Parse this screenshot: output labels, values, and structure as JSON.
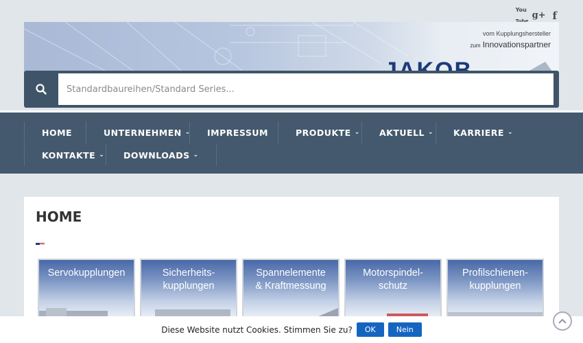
{
  "social": {
    "youtube_line1": "You",
    "youtube_line2": "Tube",
    "googleplus": "g+",
    "facebook": "f"
  },
  "banner": {
    "tagline_line1": "vom Kupplungshersteller",
    "tagline_prefix": "zum",
    "tagline_line2": "Innovationspartner",
    "brand": "JAKOB"
  },
  "search": {
    "placeholder": "Standardbaureihen/Standard Series..."
  },
  "nav": {
    "items": [
      {
        "label": "HOME",
        "has_dropdown": false
      },
      {
        "label": "UNTERNEHMEN",
        "has_dropdown": true
      },
      {
        "label": "IMPRESSUM",
        "has_dropdown": false
      },
      {
        "label": "PRODUKTE",
        "has_dropdown": true
      },
      {
        "label": "AKTUELL",
        "has_dropdown": true
      },
      {
        "label": "KARRIERE",
        "has_dropdown": true
      },
      {
        "label": "KONTAKTE",
        "has_dropdown": true
      },
      {
        "label": "DOWNLOADS",
        "has_dropdown": true
      }
    ],
    "chevron": "⌄"
  },
  "main": {
    "title": "HOME",
    "tiles": [
      {
        "line1": "Servokupplungen",
        "line2": ""
      },
      {
        "line1": "Sicherheits-",
        "line2": "kupplungen"
      },
      {
        "line1": "Spannelemente",
        "line2": "& Kraftmessung"
      },
      {
        "line1": "Motorspindel-",
        "line2": "schutz"
      },
      {
        "line1": "Profilschienen-",
        "line2": "kupplungen"
      }
    ]
  },
  "cookie": {
    "text": "Diese Website nutzt Cookies. Stimmen Sie zu?",
    "ok": "OK",
    "no": "Nein"
  },
  "colors": {
    "nav_bg": "#44596d",
    "search_bg": "#3f5468",
    "button_blue": "#1565c0",
    "page_bg": "#e1e6ea"
  }
}
